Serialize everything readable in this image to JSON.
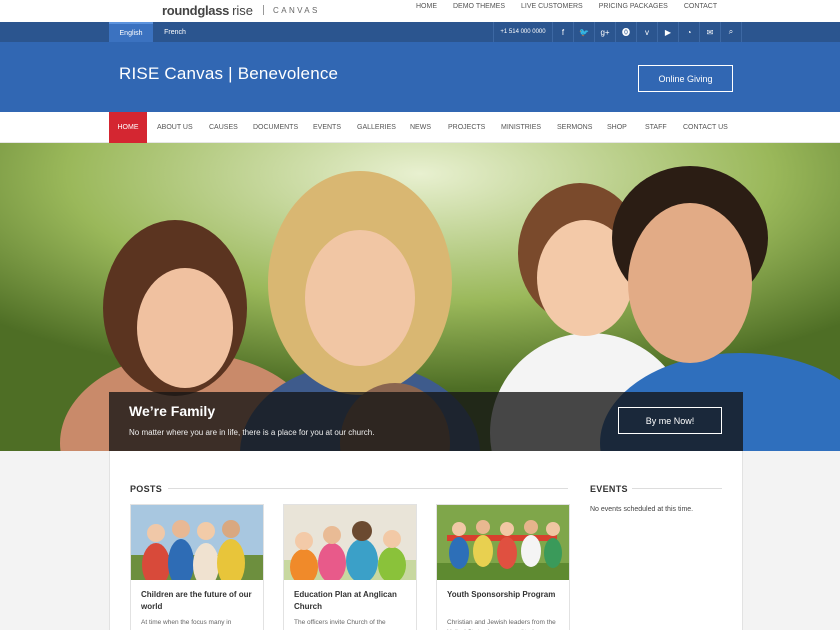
{
  "topbar": {
    "logo_main": "roundglass",
    "logo_rise": "rise",
    "logo_sub": "CANVAS",
    "nav": [
      "HOME",
      "DEMO THEMES",
      "LIVE CUSTOMERS",
      "PRICING PACKAGES",
      "CONTACT"
    ]
  },
  "langbar": {
    "languages": [
      "English",
      "French"
    ],
    "phone": "+1 514 000 0000",
    "social_icons": [
      {
        "icon": "facebook-icon",
        "glyph": "f"
      },
      {
        "icon": "twitter-icon",
        "glyph": "🐦"
      },
      {
        "icon": "google-plus-icon",
        "glyph": "g+"
      },
      {
        "icon": "pinterest-icon",
        "glyph": "⓿"
      },
      {
        "icon": "vimeo-icon",
        "glyph": "v"
      },
      {
        "icon": "youtube-icon",
        "glyph": "▶"
      },
      {
        "icon": "rss-icon",
        "glyph": "◔"
      },
      {
        "icon": "email-icon",
        "glyph": "✉"
      },
      {
        "icon": "search-icon",
        "glyph": "⌕"
      }
    ]
  },
  "header": {
    "title": "RISE Canvas | Benevolence",
    "giving_button": "Online Giving"
  },
  "mainnav": {
    "items": [
      "HOME",
      "ABOUT US",
      "CAUSES",
      "DOCUMENTS",
      "EVENTS",
      "GALLERIES",
      "NEWS",
      "PROJECTS",
      "MINISTRIES",
      "SERMONS",
      "SHOP",
      "STAFF",
      "CONTACT US"
    ]
  },
  "hero": {
    "title": "We’re Family",
    "subtitle": "No matter where you are in life, there is a place for you at our church.",
    "button": "By me Now!"
  },
  "posts": {
    "heading": "POSTS",
    "cards": [
      {
        "title": "Children are the future of our world",
        "excerpt": "At time when the focus many in"
      },
      {
        "title": "Education Plan at Anglican Church",
        "excerpt": "The officers invite Church of the"
      },
      {
        "title": "Youth Sponsorship Program",
        "excerpt": "Christian and Jewish leaders from the United States have committed"
      }
    ]
  },
  "events": {
    "heading": "EVENTS",
    "note": "No events scheduled at this time."
  },
  "colors": {
    "langbar": "#2b558f",
    "header": "#3167b3",
    "nav_active": "#d42631"
  }
}
